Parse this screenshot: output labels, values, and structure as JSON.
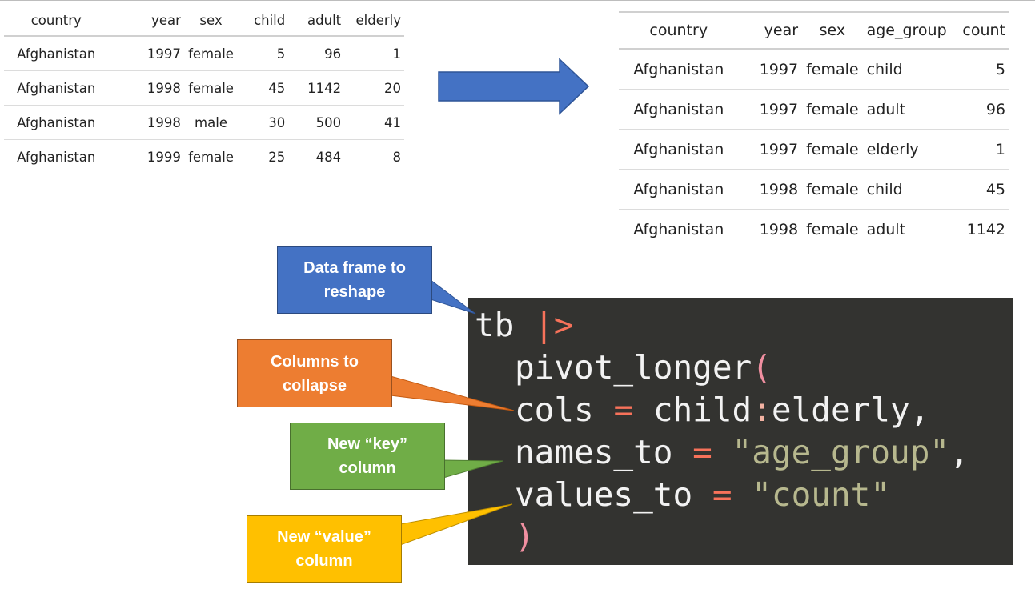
{
  "wide_table": {
    "headers": [
      "country",
      "year",
      "sex",
      "child",
      "adult",
      "elderly"
    ],
    "rows": [
      [
        "Afghanistan",
        "1997",
        "female",
        "5",
        "96",
        "1"
      ],
      [
        "Afghanistan",
        "1998",
        "female",
        "45",
        "1142",
        "20"
      ],
      [
        "Afghanistan",
        "1998",
        "male",
        "30",
        "500",
        "41"
      ],
      [
        "Afghanistan",
        "1999",
        "female",
        "25",
        "484",
        "8"
      ]
    ]
  },
  "long_table": {
    "headers": [
      "country",
      "year",
      "sex",
      "age_group",
      "count"
    ],
    "rows": [
      [
        "Afghanistan",
        "1997",
        "female",
        "child",
        "5"
      ],
      [
        "Afghanistan",
        "1997",
        "female",
        "adult",
        "96"
      ],
      [
        "Afghanistan",
        "1997",
        "female",
        "elderly",
        "1"
      ],
      [
        "Afghanistan",
        "1998",
        "female",
        "child",
        "45"
      ],
      [
        "Afghanistan",
        "1998",
        "female",
        "adult",
        "1142"
      ]
    ]
  },
  "code": {
    "df": "tb",
    "pipe": "|>",
    "func": "pivot_longer",
    "open_paren": "(",
    "close_paren": ")",
    "cols_arg": "cols",
    "eq": "=",
    "cols_from": "child",
    "colon": ":",
    "cols_to": "elderly",
    "comma": ",",
    "names_arg": "names_to",
    "names_val": "\"age_group\"",
    "values_arg": "values_to",
    "values_val": "\"count\""
  },
  "callouts": {
    "data_frame": [
      "Data frame to",
      "reshape"
    ],
    "columns": [
      "Columns to",
      "collapse"
    ],
    "key": [
      "New “key”",
      "column"
    ],
    "value": [
      "New “value”",
      "column"
    ]
  },
  "colors": {
    "arrow": "#4472C4",
    "data_frame": "#4472C4",
    "columns": "#ED7D31",
    "key": "#70AD47",
    "value": "#FFC000",
    "code_bg": "#333330"
  }
}
